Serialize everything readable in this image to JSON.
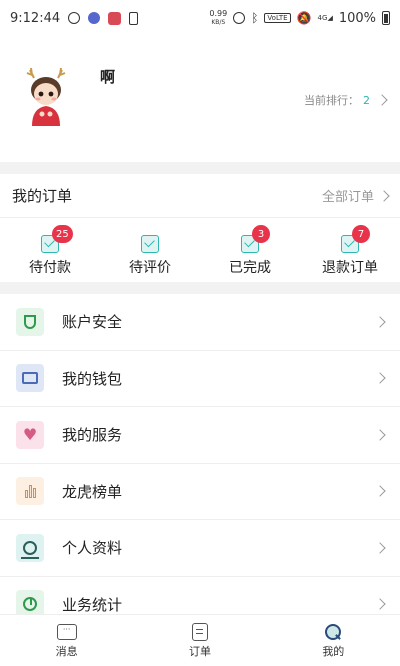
{
  "status_bar": {
    "time": "9:12:44",
    "net_speed_value": "0.99",
    "net_speed_unit": "KB/S",
    "volte": "VoLTE",
    "signal": "4G",
    "battery": "100%"
  },
  "profile": {
    "username": "啊",
    "rank_label": "当前排行：",
    "rank_value": "2"
  },
  "orders": {
    "title": "我的订单",
    "all_label": "全部订单",
    "items": [
      {
        "label": "待付款",
        "badge": "25"
      },
      {
        "label": "待评价",
        "badge": ""
      },
      {
        "label": "已完成",
        "badge": "3"
      },
      {
        "label": "退款订单",
        "badge": "7"
      }
    ]
  },
  "menu": [
    {
      "label": "账户安全",
      "icon": "shield-icon",
      "bg": "#e6f5ea"
    },
    {
      "label": "我的钱包",
      "icon": "wallet-icon",
      "bg": "#dfe6f6"
    },
    {
      "label": "我的服务",
      "icon": "heart-icon",
      "bg": "#fae1ea"
    },
    {
      "label": "龙虎榜单",
      "icon": "bar-chart-icon",
      "bg": "#fdf0e3"
    },
    {
      "label": "个人资料",
      "icon": "user-icon",
      "bg": "#def3f1"
    },
    {
      "label": "业务统计",
      "icon": "pie-chart-icon",
      "bg": "#e6f5ea"
    }
  ],
  "tabs": [
    {
      "label": "消息",
      "icon": "message-icon"
    },
    {
      "label": "订单",
      "icon": "order-icon"
    },
    {
      "label": "我的",
      "icon": "profile-icon"
    }
  ],
  "colors": {
    "accent": "#2db7b0",
    "badge": "#e8334a",
    "band": "#f2f2f2"
  }
}
